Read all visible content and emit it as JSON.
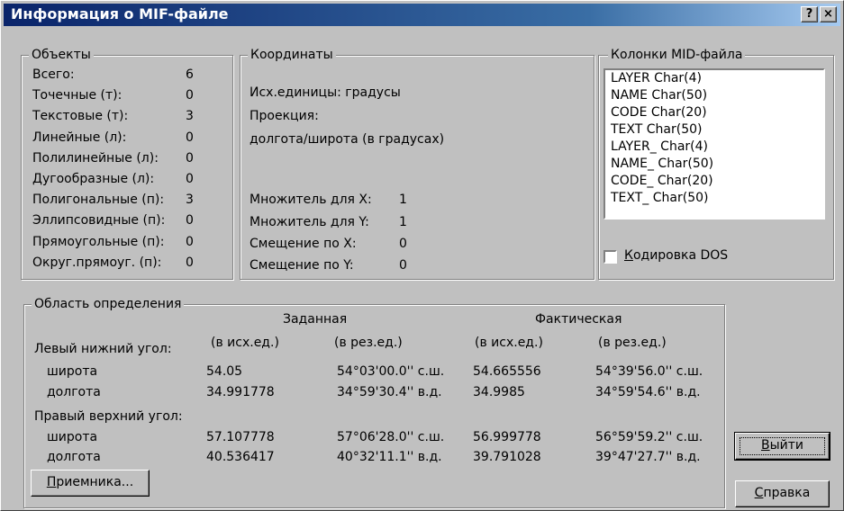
{
  "window": {
    "title": "Информация о MIF-файле",
    "help_button": "?",
    "close_button": "×"
  },
  "objects": {
    "legend": "Объекты",
    "rows": [
      {
        "label": "Всего:",
        "value": "6"
      },
      {
        "label": "Точечные (т):",
        "value": "0"
      },
      {
        "label": "Текстовые (т):",
        "value": "3"
      },
      {
        "label": "Линейные (л):",
        "value": "0"
      },
      {
        "label": "Полилинейные (л):",
        "value": "0"
      },
      {
        "label": "Дугообразные (л):",
        "value": "0"
      },
      {
        "label": "Полигональные (п):",
        "value": "3"
      },
      {
        "label": "Эллипсовидные (п):",
        "value": "0"
      },
      {
        "label": "Прямоугольные (п):",
        "value": "0"
      },
      {
        "label": "Округ.прямоуг. (п):",
        "value": "0"
      }
    ]
  },
  "coords": {
    "legend": "Координаты",
    "units": "Исх.единицы:  градусы",
    "projection_label": "Проекция:",
    "projection_value": "долгота/широта (в градусах)",
    "mult_x_label": "Множитель для X:",
    "mult_x": "1",
    "mult_y_label": "Множитель для Y:",
    "mult_y": "1",
    "shift_x_label": "Смещение по X:",
    "shift_x": "0",
    "shift_y_label": "Смещение по Y:",
    "shift_y": "0"
  },
  "mid_columns": {
    "legend": "Колонки MID-файла",
    "items": [
      "LAYER Char(4)",
      "NAME Char(50)",
      "CODE Char(20)",
      "TEXT Char(50)",
      "LAYER_ Char(4)",
      "NAME_ Char(50)",
      "CODE_ Char(20)",
      "TEXT_ Char(50)"
    ],
    "dos_encoding_label": "Кодировка DOS",
    "dos_encoding_checked": false
  },
  "extent": {
    "legend": "Область определения",
    "given_header": "Заданная",
    "actual_header": "Фактическая",
    "src_units": "(в исх.ед.)",
    "res_units": "(в рез.ед.)",
    "lower_left_label": "Левый нижний угол:",
    "upper_right_label": "Правый верхний угол:",
    "lat_label": "широта",
    "lon_label": "долгота",
    "ll": {
      "lat": [
        "54.05",
        "54°03'00.0'' с.ш.",
        "54.665556",
        "54°39'56.0'' с.ш."
      ],
      "lon": [
        "34.991778",
        "34°59'30.4'' в.д.",
        "34.9985",
        "34°59'54.6'' в.д."
      ]
    },
    "ur": {
      "lat": [
        "57.107778",
        "57°06'28.0'' с.ш.",
        "56.999778",
        "56°59'59.2'' с.ш."
      ],
      "lon": [
        "40.536417",
        "40°32'11.1'' в.д.",
        "39.791028",
        "39°47'27.7'' в.д."
      ]
    }
  },
  "buttons": {
    "receiver": "Приемника...",
    "exit": "Выйти",
    "help": "Справка"
  }
}
